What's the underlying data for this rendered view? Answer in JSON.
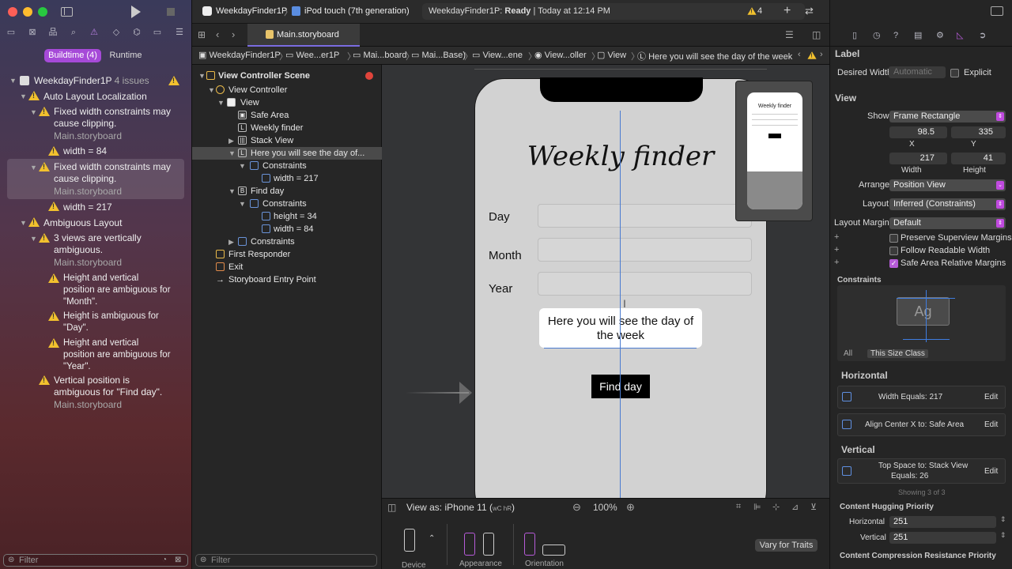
{
  "navigator": {
    "tab_buildtime": "Buildtime (4)",
    "tab_runtime": "Runtime",
    "project": "WeekdayFinder1P",
    "project_issues": "4 issues",
    "group1": "Auto Layout Localization",
    "issue1": [
      "Fixed width constraints may",
      "cause clipping."
    ],
    "issue1_file": "Main.storyboard",
    "issue1_detail": "width = 84",
    "issue2": [
      "Fixed width constraints may",
      "cause clipping."
    ],
    "issue2_file": "Main.storyboard",
    "issue2_detail": "width = 217",
    "group2": "Ambiguous Layout",
    "issue3": [
      "3 views are vertically",
      "ambiguous."
    ],
    "issue3_file": "Main.storyboard",
    "d1": [
      "Height and vertical",
      "position are ambiguous for",
      "\"Month\"."
    ],
    "d2": [
      "Height is ambiguous for",
      "\"Day\"."
    ],
    "d3": [
      "Height and vertical",
      "position are ambiguous for",
      "\"Year\"."
    ],
    "issue4": [
      "Vertical position is",
      "ambiguous for \"Find day\"."
    ],
    "issue4_file": "Main.storyboard",
    "filter_placeholder": "Filter"
  },
  "toolbar": {
    "scheme": "WeekdayFinder1P",
    "device": "iPod touch (7th generation)",
    "status_prefix": "WeekdayFinder1P: ",
    "status_state": "Ready",
    "status_time": "Today at 12:14 PM",
    "warning_count": "4",
    "tab_file": "Main.storyboard"
  },
  "jumpbar": [
    "WeekdayFinder1P",
    "Wee...er1P",
    "Mai...board",
    "Mai...Base)",
    "View...ene",
    "View...oller",
    "View",
    "Here you will see the day of the week"
  ],
  "outline": {
    "scene": "View Controller Scene",
    "vc": "View Controller",
    "view": "View",
    "safe_area": "Safe Area",
    "weekly_finder": "Weekly finder",
    "stack_view": "Stack View",
    "here_label": "Here you will see the day of...",
    "constraints": "Constraints",
    "width217": "width = 217",
    "find_day": "Find day",
    "height34": "height = 34",
    "width84": "width = 84",
    "first_responder": "First Responder",
    "exit": "Exit",
    "entry_point": "Storyboard Entry Point",
    "filter_placeholder": "Filter"
  },
  "canvas": {
    "title": "Weekly finder",
    "day": "Day",
    "month": "Month",
    "year": "Year",
    "result_label": "Here you will see the day of the week",
    "button": "Find day",
    "thumb_title": "Weekly finder",
    "view_as": "View as: iPhone 11 (",
    "view_as_traits": "wC hR",
    "zoom": "100%",
    "device": "Device",
    "appearance": "Appearance",
    "orientation": "Orientation",
    "vary": "Vary for Traits"
  },
  "inspector": {
    "label_hdr": "Label",
    "desired_width": "Desired Width",
    "automatic": "Automatic",
    "explicit": "Explicit",
    "view_hdr": "View",
    "show": "Show",
    "show_val": "Frame Rectangle",
    "x_val": "98.5",
    "y_val": "335",
    "x_lbl": "X",
    "y_lbl": "Y",
    "w_val": "217",
    "h_val": "41",
    "w_lbl": "Width",
    "h_lbl": "Height",
    "arrange": "Arrange",
    "arrange_val": "Position View",
    "layout": "Layout",
    "layout_val": "Inferred (Constraints)",
    "margins": "Layout Margins",
    "margins_val": "Default",
    "preserve": "Preserve Superview Margins",
    "follow": "Follow Readable Width",
    "safe_rel": "Safe Area Relative Margins",
    "constraints_hdr": "Constraints",
    "all": "All",
    "size_class": "This Size Class",
    "horizontal_hdr": "Horizontal",
    "c1": "Width Equals:  217",
    "c2": "Align Center X to:  Safe Area",
    "edit": "Edit",
    "vertical_hdr": "Vertical",
    "c3a": "Top Space to:  Stack View",
    "c3b": "Equals:  26",
    "showing": "Showing 3 of 3",
    "hugging": "Content Hugging Priority",
    "h_lbl2": "Horizontal",
    "v_lbl2": "Vertical",
    "hug_h": "251",
    "hug_v": "251",
    "compression": "Content Compression Resistance Priority"
  }
}
